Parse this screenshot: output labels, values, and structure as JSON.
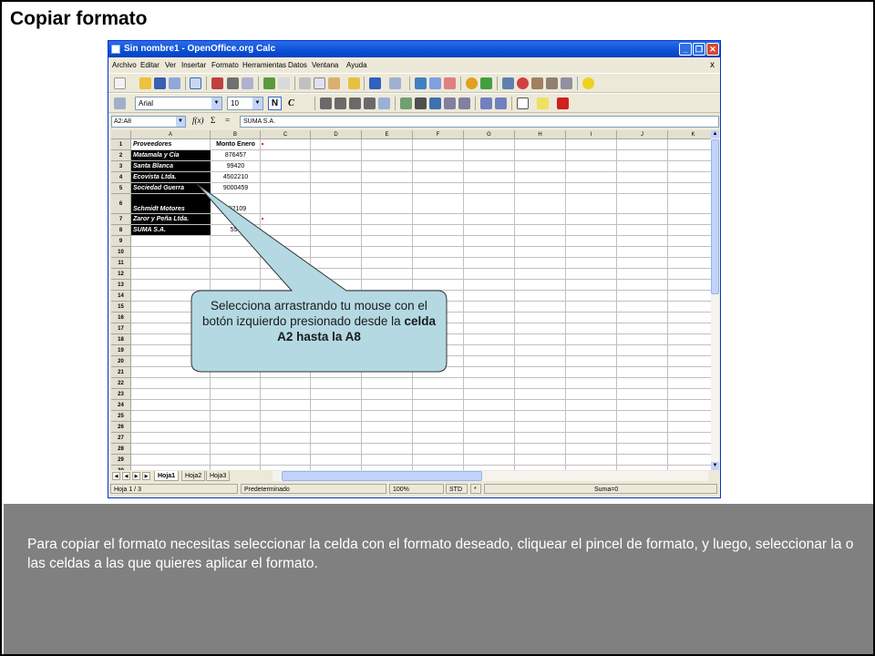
{
  "slide": {
    "title": "Copiar formato",
    "description": "Para copiar el formato necesitas seleccionar la celda con el formato deseado, cliquear el pincel de formato, y luego, seleccionar la o las celdas a las que quieres aplicar el formato."
  },
  "window": {
    "title": "Sin nombre1 - OpenOffice.org Calc",
    "menu": [
      "Archivo",
      "Editar",
      "Ver",
      "Insertar",
      "Formato",
      "Herramientas",
      "Datos",
      "Ventana",
      "Ayuda"
    ],
    "doc_close": "x"
  },
  "toolbar2": {
    "font_name": "Arial",
    "font_size": "10",
    "bold": "N",
    "italic": "C"
  },
  "formula_bar": {
    "name_box": "A2:A8",
    "fx": "f(x)",
    "sum": "Σ",
    "equals": "=",
    "content": "SUMA S.A."
  },
  "grid": {
    "columns": [
      "A",
      "B",
      "C",
      "D",
      "E",
      "F",
      "G",
      "H",
      "I",
      "J",
      "K"
    ],
    "rows": [
      "1",
      "2",
      "3",
      "4",
      "5",
      "6",
      "7",
      "8",
      "9",
      "10",
      "11",
      "12",
      "13",
      "14",
      "15",
      "16",
      "17",
      "18",
      "19",
      "20",
      "21",
      "22",
      "23",
      "24",
      "25",
      "26",
      "27",
      "28",
      "29",
      "30"
    ],
    "header_a": "Proveedores",
    "header_b": "Monto Enero",
    "data_rows": [
      {
        "name": "Matamala y Cía",
        "amount": "876457"
      },
      {
        "name": "Santa Blanca",
        "amount": "99420"
      },
      {
        "name": "Ecovista Ltda.",
        "amount": "4502210"
      },
      {
        "name": "Sociedad Guerra",
        "amount": "9000459"
      },
      {
        "name": "Schmidt Motores",
        "amount": "892109"
      },
      {
        "name": "Zaror y Peña Ltda.",
        "amount": "5509"
      },
      {
        "name": "SUMA S.A.",
        "amount": "559"
      }
    ]
  },
  "sheet_tabs": [
    "Hoja1",
    "Hoja2",
    "Hoja3"
  ],
  "statusbar": {
    "sheet": "Hoja 1 / 3",
    "style": "Predeterminado",
    "zoom": "100%",
    "mode": "STD",
    "modified": "*",
    "sum": "Suma=0"
  },
  "callout": {
    "text_before": "Selecciona arrastrando tu mouse con el botón izquierdo presionado desde la ",
    "text_bold": "celda A2 hasta la A8",
    "fill": "#b4d9e3"
  },
  "colors": {
    "panel": "#808080",
    "titlebar": "#0a4fd6"
  }
}
